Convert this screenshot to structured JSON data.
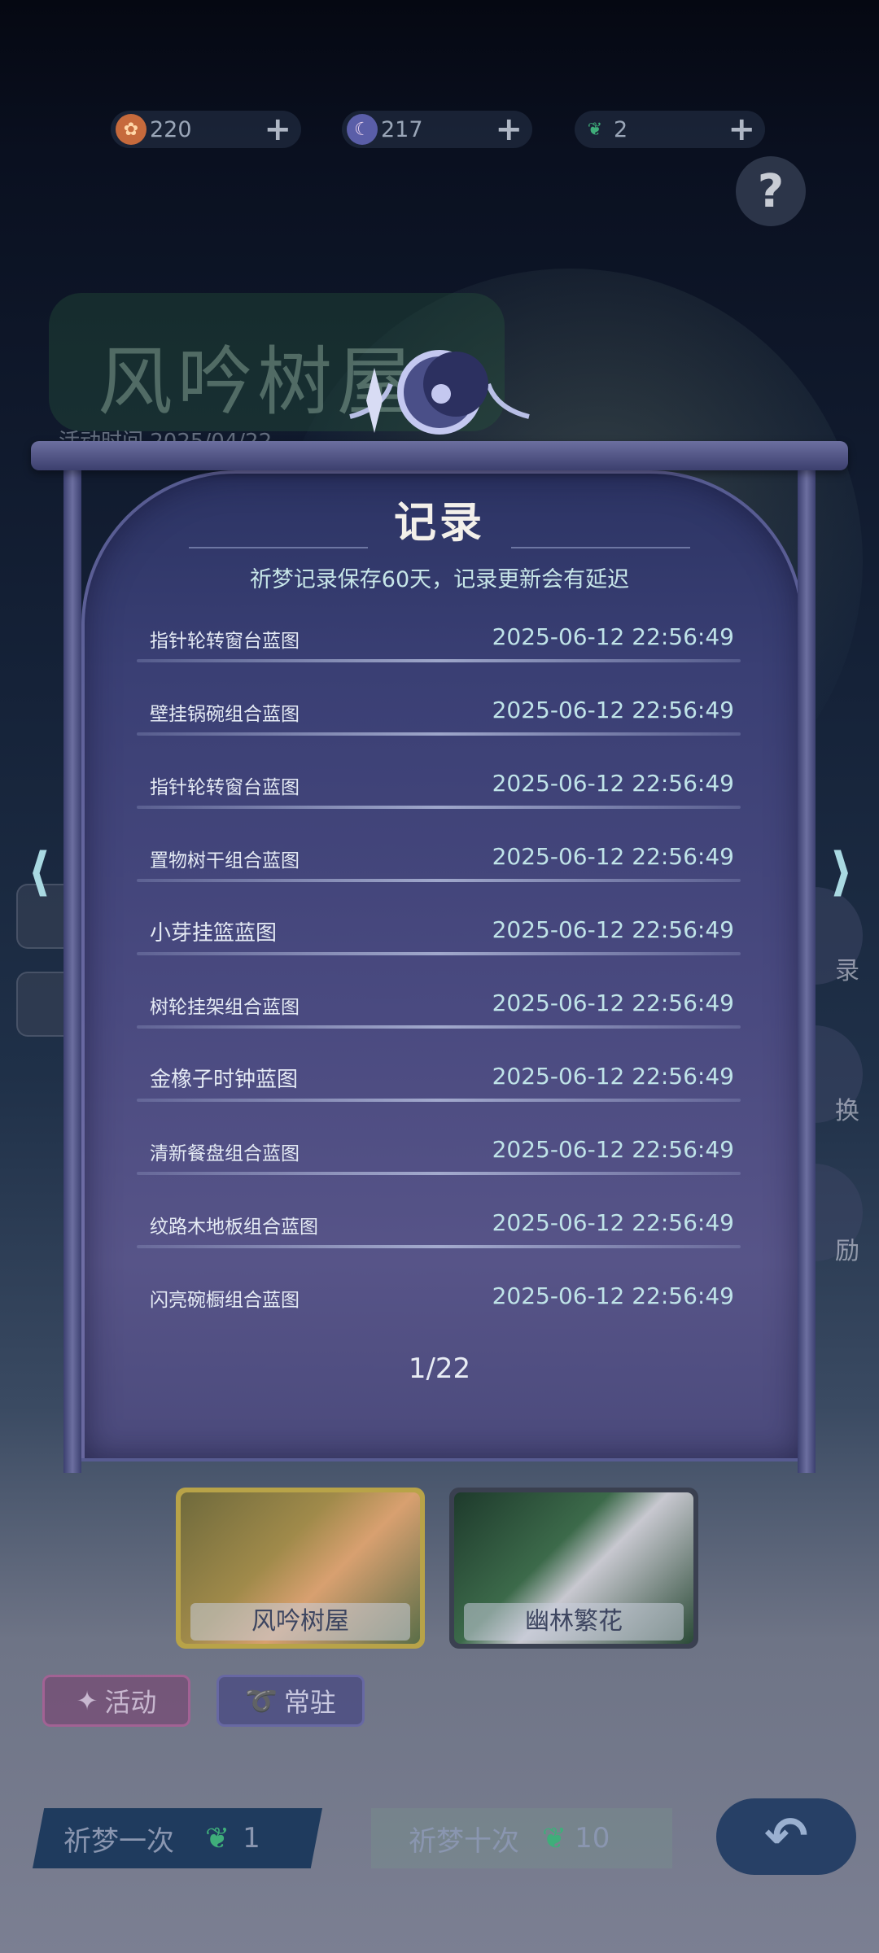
{
  "currencies": [
    {
      "value": "220",
      "icon": "flower-coin-icon"
    },
    {
      "value": "217",
      "icon": "moon-coin-icon"
    },
    {
      "value": "2",
      "icon": "feather-icon"
    }
  ],
  "background": {
    "event_title": "风吟树屋",
    "event_time": "活动时间 2025/04/22",
    "side_labels": [
      "录",
      "换",
      "励"
    ]
  },
  "modal": {
    "title": "记录",
    "subtitle": "祈梦记录保存60天，记录更新会有延迟",
    "records": [
      {
        "name": "指针轮转窗台蓝图",
        "time": "2025-06-12 22:56:49"
      },
      {
        "name": "壁挂锅碗组合蓝图",
        "time": "2025-06-12 22:56:49"
      },
      {
        "name": "指针轮转窗台蓝图",
        "time": "2025-06-12 22:56:49"
      },
      {
        "name": "置物树干组合蓝图",
        "time": "2025-06-12 22:56:49"
      },
      {
        "name": "小芽挂篮蓝图",
        "time": "2025-06-12 22:56:49"
      },
      {
        "name": "树轮挂架组合蓝图",
        "time": "2025-06-12 22:56:49"
      },
      {
        "name": "金橡子时钟蓝图",
        "time": "2025-06-12 22:56:49"
      },
      {
        "name": "清新餐盘组合蓝图",
        "time": "2025-06-12 22:56:49"
      },
      {
        "name": "纹路木地板组合蓝图",
        "time": "2025-06-12 22:56:49"
      },
      {
        "name": "闪亮碗橱组合蓝图",
        "time": "2025-06-12 22:56:49"
      }
    ],
    "pager": "1/22"
  },
  "banners": [
    {
      "label": "风吟树屋"
    },
    {
      "label": "幽林繁花"
    }
  ],
  "tabs": [
    {
      "label": "活动"
    },
    {
      "label": "常驻"
    }
  ],
  "pray": {
    "once_label": "祈梦一次",
    "once_cost": "1",
    "ten_label": "祈梦十次",
    "ten_cost": "10"
  }
}
